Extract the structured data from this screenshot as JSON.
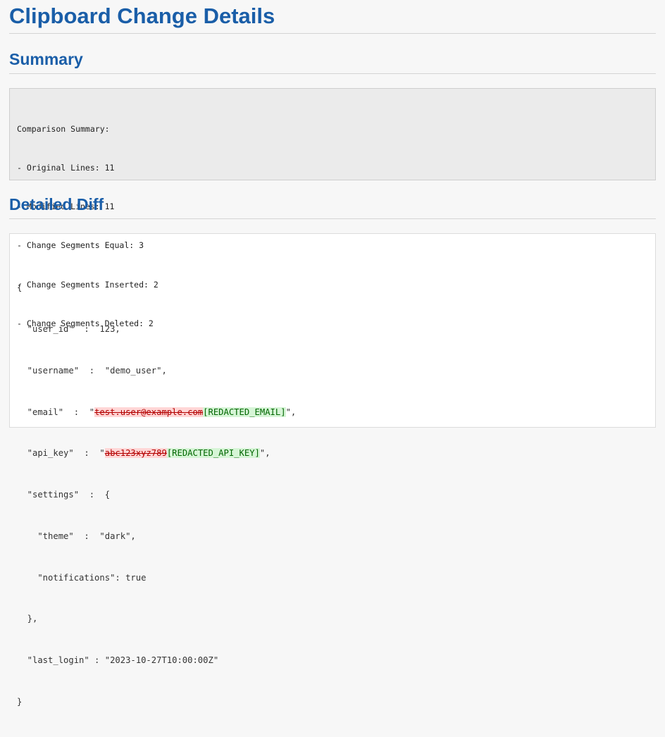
{
  "title": "Clipboard Change Details",
  "summary": {
    "heading": "Summary",
    "lines": [
      "Comparison Summary:",
      "- Original Lines: 11",
      "- Modified Lines: 11",
      "- Change Segments Equal: 3",
      "- Change Segments Inserted: 2",
      "- Change Segments Deleted: 2"
    ]
  },
  "diff": {
    "heading": "Detailed Diff",
    "lines": [
      {
        "text": "{"
      },
      {
        "text": "  \"user_id\"  :  123,"
      },
      {
        "text": "  \"username\"  :  \"demo_user\","
      },
      {
        "pre": "  \"email\"  :  \"",
        "deleted": "test.user@example.com",
        "inserted": "[REDACTED_EMAIL]",
        "post": "\","
      },
      {
        "pre": "  \"api_key\"  :  \"",
        "deleted": "abc123xyz789",
        "inserted": "[REDACTED_API_KEY]",
        "post": "\","
      },
      {
        "text": "  \"settings\"  :  {"
      },
      {
        "text": "    \"theme\"  :  \"dark\","
      },
      {
        "text": "    \"notifications\": true"
      },
      {
        "text": "  },"
      },
      {
        "text": "  \"last_login\" : \"2023-10-27T10:00:00Z\""
      },
      {
        "text": "}"
      }
    ]
  },
  "colors": {
    "heading": "#1a5ea8",
    "deleted_bg": "#ffd6d6",
    "deleted_fg": "#b30000",
    "inserted_bg": "#d6f5d6",
    "inserted_fg": "#006600"
  }
}
